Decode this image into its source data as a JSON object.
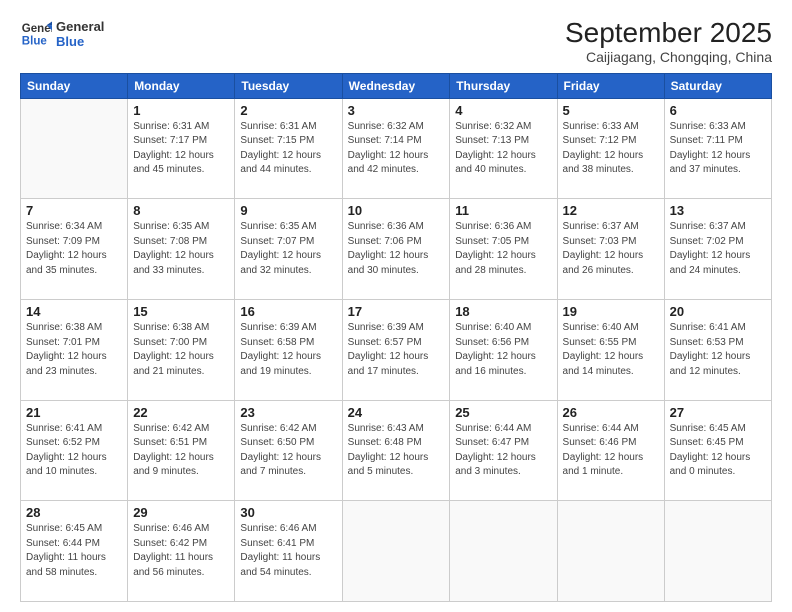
{
  "logo": {
    "line1": "General",
    "line2": "Blue"
  },
  "title": "September 2025",
  "location": "Caijiagang, Chongqing, China",
  "headers": [
    "Sunday",
    "Monday",
    "Tuesday",
    "Wednesday",
    "Thursday",
    "Friday",
    "Saturday"
  ],
  "weeks": [
    [
      {
        "day": "",
        "info": ""
      },
      {
        "day": "1",
        "info": "Sunrise: 6:31 AM\nSunset: 7:17 PM\nDaylight: 12 hours\nand 45 minutes."
      },
      {
        "day": "2",
        "info": "Sunrise: 6:31 AM\nSunset: 7:15 PM\nDaylight: 12 hours\nand 44 minutes."
      },
      {
        "day": "3",
        "info": "Sunrise: 6:32 AM\nSunset: 7:14 PM\nDaylight: 12 hours\nand 42 minutes."
      },
      {
        "day": "4",
        "info": "Sunrise: 6:32 AM\nSunset: 7:13 PM\nDaylight: 12 hours\nand 40 minutes."
      },
      {
        "day": "5",
        "info": "Sunrise: 6:33 AM\nSunset: 7:12 PM\nDaylight: 12 hours\nand 38 minutes."
      },
      {
        "day": "6",
        "info": "Sunrise: 6:33 AM\nSunset: 7:11 PM\nDaylight: 12 hours\nand 37 minutes."
      }
    ],
    [
      {
        "day": "7",
        "info": "Sunrise: 6:34 AM\nSunset: 7:09 PM\nDaylight: 12 hours\nand 35 minutes."
      },
      {
        "day": "8",
        "info": "Sunrise: 6:35 AM\nSunset: 7:08 PM\nDaylight: 12 hours\nand 33 minutes."
      },
      {
        "day": "9",
        "info": "Sunrise: 6:35 AM\nSunset: 7:07 PM\nDaylight: 12 hours\nand 32 minutes."
      },
      {
        "day": "10",
        "info": "Sunrise: 6:36 AM\nSunset: 7:06 PM\nDaylight: 12 hours\nand 30 minutes."
      },
      {
        "day": "11",
        "info": "Sunrise: 6:36 AM\nSunset: 7:05 PM\nDaylight: 12 hours\nand 28 minutes."
      },
      {
        "day": "12",
        "info": "Sunrise: 6:37 AM\nSunset: 7:03 PM\nDaylight: 12 hours\nand 26 minutes."
      },
      {
        "day": "13",
        "info": "Sunrise: 6:37 AM\nSunset: 7:02 PM\nDaylight: 12 hours\nand 24 minutes."
      }
    ],
    [
      {
        "day": "14",
        "info": "Sunrise: 6:38 AM\nSunset: 7:01 PM\nDaylight: 12 hours\nand 23 minutes."
      },
      {
        "day": "15",
        "info": "Sunrise: 6:38 AM\nSunset: 7:00 PM\nDaylight: 12 hours\nand 21 minutes."
      },
      {
        "day": "16",
        "info": "Sunrise: 6:39 AM\nSunset: 6:58 PM\nDaylight: 12 hours\nand 19 minutes."
      },
      {
        "day": "17",
        "info": "Sunrise: 6:39 AM\nSunset: 6:57 PM\nDaylight: 12 hours\nand 17 minutes."
      },
      {
        "day": "18",
        "info": "Sunrise: 6:40 AM\nSunset: 6:56 PM\nDaylight: 12 hours\nand 16 minutes."
      },
      {
        "day": "19",
        "info": "Sunrise: 6:40 AM\nSunset: 6:55 PM\nDaylight: 12 hours\nand 14 minutes."
      },
      {
        "day": "20",
        "info": "Sunrise: 6:41 AM\nSunset: 6:53 PM\nDaylight: 12 hours\nand 12 minutes."
      }
    ],
    [
      {
        "day": "21",
        "info": "Sunrise: 6:41 AM\nSunset: 6:52 PM\nDaylight: 12 hours\nand 10 minutes."
      },
      {
        "day": "22",
        "info": "Sunrise: 6:42 AM\nSunset: 6:51 PM\nDaylight: 12 hours\nand 9 minutes."
      },
      {
        "day": "23",
        "info": "Sunrise: 6:42 AM\nSunset: 6:50 PM\nDaylight: 12 hours\nand 7 minutes."
      },
      {
        "day": "24",
        "info": "Sunrise: 6:43 AM\nSunset: 6:48 PM\nDaylight: 12 hours\nand 5 minutes."
      },
      {
        "day": "25",
        "info": "Sunrise: 6:44 AM\nSunset: 6:47 PM\nDaylight: 12 hours\nand 3 minutes."
      },
      {
        "day": "26",
        "info": "Sunrise: 6:44 AM\nSunset: 6:46 PM\nDaylight: 12 hours\nand 1 minute."
      },
      {
        "day": "27",
        "info": "Sunrise: 6:45 AM\nSunset: 6:45 PM\nDaylight: 12 hours\nand 0 minutes."
      }
    ],
    [
      {
        "day": "28",
        "info": "Sunrise: 6:45 AM\nSunset: 6:44 PM\nDaylight: 11 hours\nand 58 minutes."
      },
      {
        "day": "29",
        "info": "Sunrise: 6:46 AM\nSunset: 6:42 PM\nDaylight: 11 hours\nand 56 minutes."
      },
      {
        "day": "30",
        "info": "Sunrise: 6:46 AM\nSunset: 6:41 PM\nDaylight: 11 hours\nand 54 minutes."
      },
      {
        "day": "",
        "info": ""
      },
      {
        "day": "",
        "info": ""
      },
      {
        "day": "",
        "info": ""
      },
      {
        "day": "",
        "info": ""
      }
    ]
  ]
}
